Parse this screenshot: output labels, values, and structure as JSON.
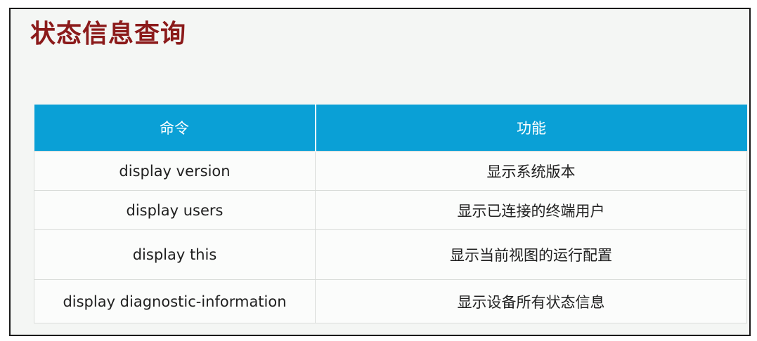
{
  "title": "状态信息查询",
  "table": {
    "headers": [
      "命令",
      "功能"
    ],
    "rows": [
      {
        "command": "display version",
        "function": "显示系统版本"
      },
      {
        "command": "display users",
        "function": "显示已连接的终端用户"
      },
      {
        "command": "display this",
        "function": "显示当前视图的运行配置"
      },
      {
        "command": "display diagnostic-information",
        "function": "显示设备所有状态信息"
      }
    ]
  },
  "colors": {
    "title": "#8b1a1a",
    "header_background": "#0aa0d6",
    "header_text": "#ffffff"
  }
}
